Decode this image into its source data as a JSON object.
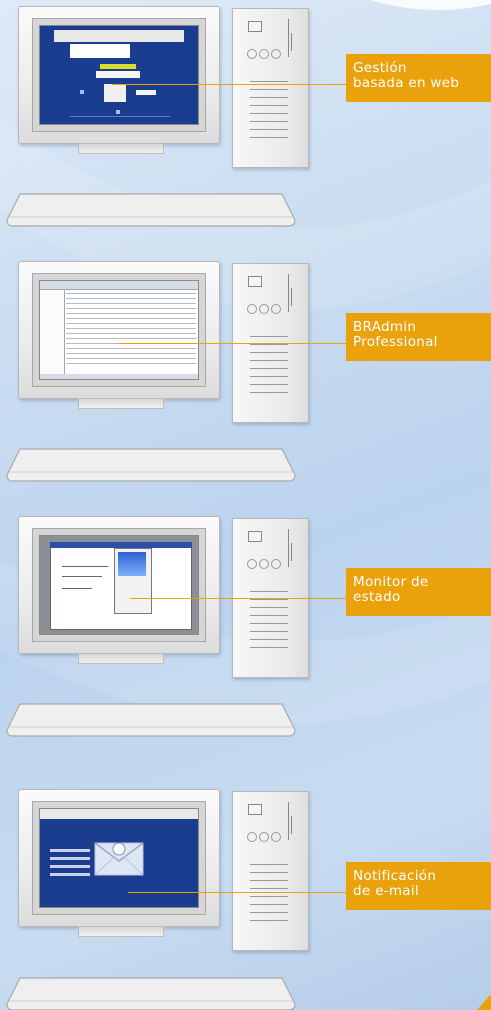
{
  "panels": [
    {
      "id": "web",
      "label_line1": "Gestión",
      "label_line2": "basada en web"
    },
    {
      "id": "bradmin",
      "label_line1": "BRAdmin",
      "label_line2": "Professional"
    },
    {
      "id": "status",
      "label_line1": "Monitor de",
      "label_line2": "estado"
    },
    {
      "id": "email",
      "label_line1": "Notificación",
      "label_line2": "de e-mail"
    }
  ],
  "colors": {
    "label_background": "#e9a10c",
    "label_text": "#ffffff",
    "web_screen": "#1a3d8f",
    "email_screen": "#1a3d8f"
  },
  "icons": [
    "monitor-icon",
    "computer-tower-icon",
    "keyboard-icon",
    "envelope-icon"
  ]
}
